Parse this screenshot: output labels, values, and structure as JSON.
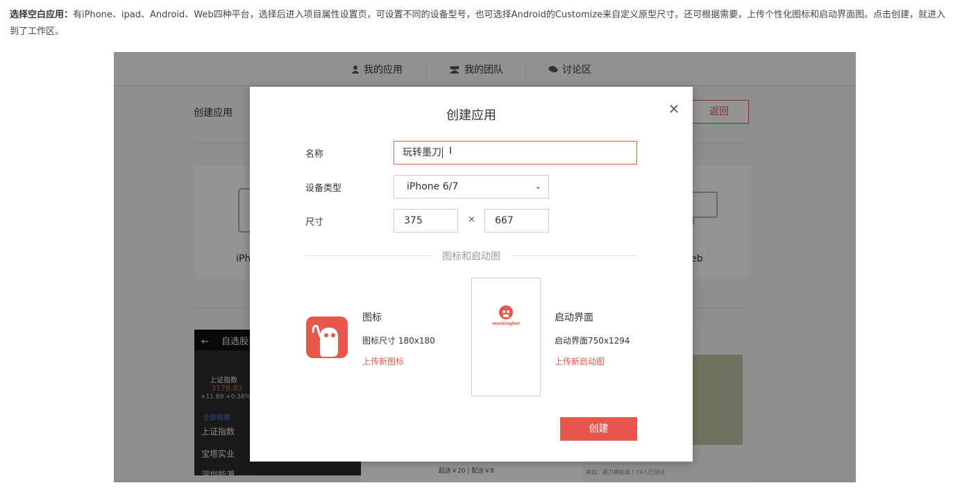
{
  "intro": {
    "bold": "选择空白应用：",
    "text": "有iPhone、ipad、Android、Web四种平台，选择后进入项目属性设置页，可设置不同的设备型号，也可选择Android的Customize来自定义原型尺寸。还可根据需要，上传个性化图标和启动界面图。点击创建，就进入到了工作区。"
  },
  "topnav": {
    "items": [
      {
        "label": "我的应用",
        "icon": "user-icon"
      },
      {
        "label": "我的团队",
        "icon": "team-icon"
      },
      {
        "label": "讨论区",
        "icon": "chat-icon"
      }
    ]
  },
  "background": {
    "title": "创建应用",
    "back_label": "返回",
    "card_label_left": "iPh",
    "card_label_right": "eb",
    "phone_header": "自选股",
    "stock_name": "上证指数",
    "stock_value": "3178.87",
    "stock_change": "+11.89  +0.38%",
    "list_heading": "全部股票",
    "list_items": [
      "上证指数",
      "宝塔实业",
      "深圳能源"
    ],
    "food_price": "起送￥20 | 配送￥8",
    "food_footer": "来自：墨刀模板城 | 19人已测试"
  },
  "modal": {
    "title": "创建应用",
    "close_icon": "close-icon",
    "name_label": "名称",
    "name_value": "玩转墨刀",
    "device_label": "设备类型",
    "device_value": "iPhone 6/7",
    "size_label": "尺寸",
    "width_value": "375",
    "times": "×",
    "height_value": "667",
    "divider_text": "图标和启动图",
    "icon_title": "图标",
    "icon_size": "图标尺寸 180x180",
    "icon_upload": "上传新图标",
    "splash_brand": "mockingbot",
    "splash_title": "启动界面",
    "splash_size": "启动界面750x1294",
    "splash_upload": "上传新启动图",
    "create_label": "创建"
  },
  "colors": {
    "accent": "#e8574b",
    "link": "#e05a4e",
    "overlay": "rgba(0,0,0,0.42)"
  }
}
